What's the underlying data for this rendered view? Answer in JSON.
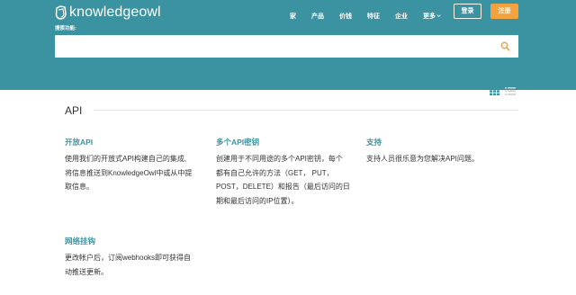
{
  "header": {
    "logo_text": "knowledgeowl",
    "nav": [
      {
        "label": "家"
      },
      {
        "label": "产品"
      },
      {
        "label": "价钱"
      },
      {
        "label": "特征"
      },
      {
        "label": "企业"
      },
      {
        "label": "更多"
      }
    ],
    "login_label": "登录",
    "register_label": "注册"
  },
  "search": {
    "label": "搜索功能:",
    "value": "",
    "placeholder": ""
  },
  "view_toggle": {
    "active": "grid-view-icon",
    "inactive": "list-view-icon"
  },
  "section": {
    "title": "API"
  },
  "cards": [
    {
      "title": "开放API",
      "lines": [
        "使用我们的开放式API构建自己的集成,",
        "将信息推送到KnowledgeOwl中或从中提",
        "取信息。"
      ]
    },
    {
      "title": "多个API密钥",
      "lines": [
        "创建用于不同用途的多个API密钥，每个",
        "都有自己允许的方法（GET，  PUT，",
        "POST，DELETE）和报告（最后访问的日",
        "期和最后访问的IP位置）。"
      ]
    },
    {
      "title": "支持",
      "lines": [
        "支持人员很乐意为您解决API问题。"
      ]
    },
    {
      "title": "网络挂钩",
      "lines": [
        "更改帐户后，订阅webhooks即可获得自",
        "动推送更新。"
      ]
    }
  ],
  "colors": {
    "header_bg": "#3b93a1",
    "accent_orange": "#f3a23e",
    "link_teal": "#3b93a1"
  }
}
